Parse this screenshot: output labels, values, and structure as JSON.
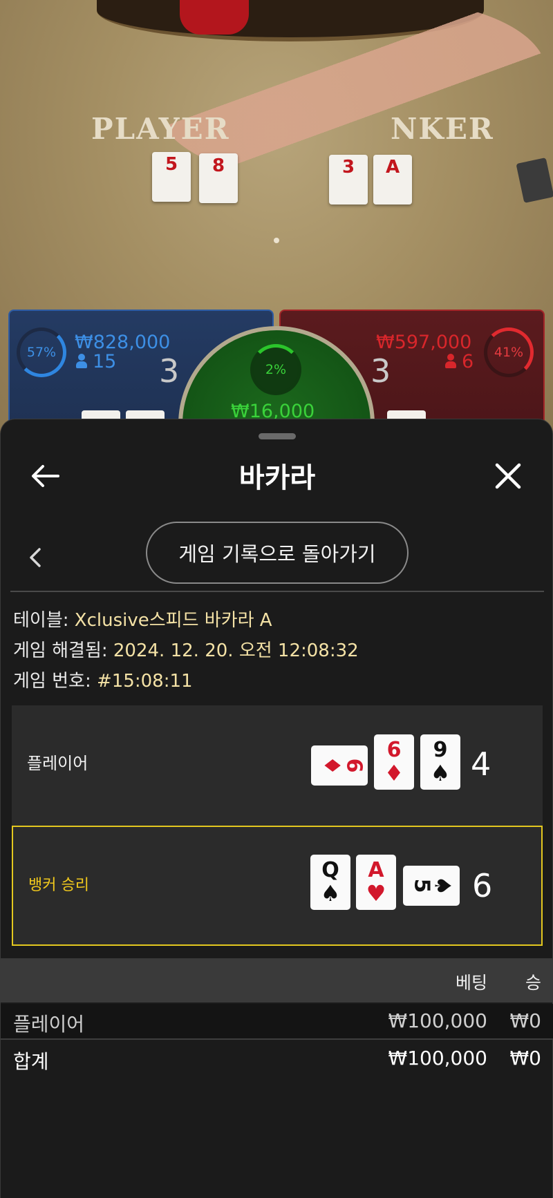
{
  "video": {
    "felt_player_label": "PLAYER",
    "felt_banker_label": "NKER",
    "felt_cards_player": [
      "5",
      "8"
    ],
    "felt_cards_banker": [
      "3",
      "A"
    ],
    "player_percent": "57%",
    "player_pot": "₩828,000",
    "player_count": "15",
    "player_score": "3",
    "banker_percent": "41%",
    "banker_pot": "₩597,000",
    "banker_count": "6",
    "banker_score": "3",
    "tie_percent": "2%",
    "tie_pot": "₩16,000",
    "colors": {
      "player": "#2f86e0",
      "banker": "#e12a2f",
      "tie": "#2bc52b"
    }
  },
  "header": {
    "title": "바카라",
    "back_icon": "arrow-left-icon",
    "close_icon": "close-icon"
  },
  "history": {
    "prev_icon": "chevron-left-icon",
    "back_to_history_label": "게임 기록으로 돌아가기"
  },
  "details": {
    "table_label": "테이블:",
    "table_value": "Xclusive스피드 바카라 A",
    "resolved_label": "게임 해결됨:",
    "resolved_value": "2024. 12. 20. 오전 12:08:32",
    "game_no_label": "게임 번호:",
    "game_no_value": "#15:08:11"
  },
  "hands": {
    "player": {
      "label": "플레이어",
      "score": "4",
      "cards": [
        {
          "rank": "6",
          "suit": "♦",
          "color": "red",
          "rotated": true
        },
        {
          "rank": "6",
          "suit": "♦",
          "color": "red",
          "rotated": false
        },
        {
          "rank": "9",
          "suit": "♠",
          "color": "black",
          "rotated": false
        }
      ]
    },
    "banker": {
      "label": "뱅커 승리",
      "score": "6",
      "cards": [
        {
          "rank": "Q",
          "suit": "♠",
          "color": "black",
          "rotated": false
        },
        {
          "rank": "A",
          "suit": "♥",
          "color": "red",
          "rotated": false
        },
        {
          "rank": "5",
          "suit": "♠",
          "color": "black",
          "rotated": true
        }
      ],
      "highlight_color": "#e4c81f"
    }
  },
  "bets": {
    "header_bet": "베팅",
    "header_win": "승",
    "rows": [
      {
        "name": "플레이어",
        "bet": "₩100,000",
        "win": "₩0"
      }
    ],
    "total": {
      "name": "합계",
      "bet": "₩100,000",
      "win": "₩0"
    }
  }
}
